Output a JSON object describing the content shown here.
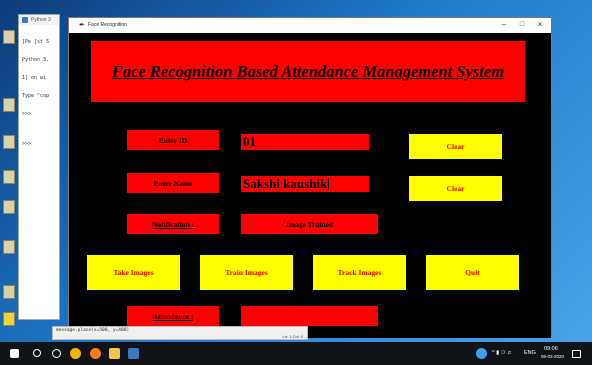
{
  "app": {
    "window_title": "Face Recognition",
    "shell_title": "Python 3",
    "shell_lines": [
      "[Pe [st 5",
      "Python 3.",
      "1] on wi",
      "Type \"cop",
      ">>>",
      "",
      ">>>"
    ],
    "status_code": "message.place(x=500, y=400)",
    "status_pos": "Ln: 1  Col: 0"
  },
  "banner": {
    "title": "Face Recognition Based Attendance Management System"
  },
  "form": {
    "enter_id_label": "Enter ID",
    "id_value": "01",
    "enter_name_label": "Enter Name",
    "name_value": "Sakshi kaushik",
    "notification_label": "Notification :",
    "notification_value": "Image Trained",
    "attendance_label": "Attendance :",
    "attendance_value": ""
  },
  "buttons": {
    "clear_id": "Clear",
    "clear_name": "Clear",
    "take_images": "Take Images",
    "train_images": "Train Images",
    "track_images": "Track Images",
    "quit": "Quit"
  },
  "taskbar": {
    "lang": "ENG",
    "time": "09:06",
    "date": "06-03-2020"
  },
  "colors": {
    "canvas_bg": "#000000",
    "label_bg": "#ff0000",
    "button_bg": "#ffff00",
    "button_fg": "#ff0000"
  }
}
